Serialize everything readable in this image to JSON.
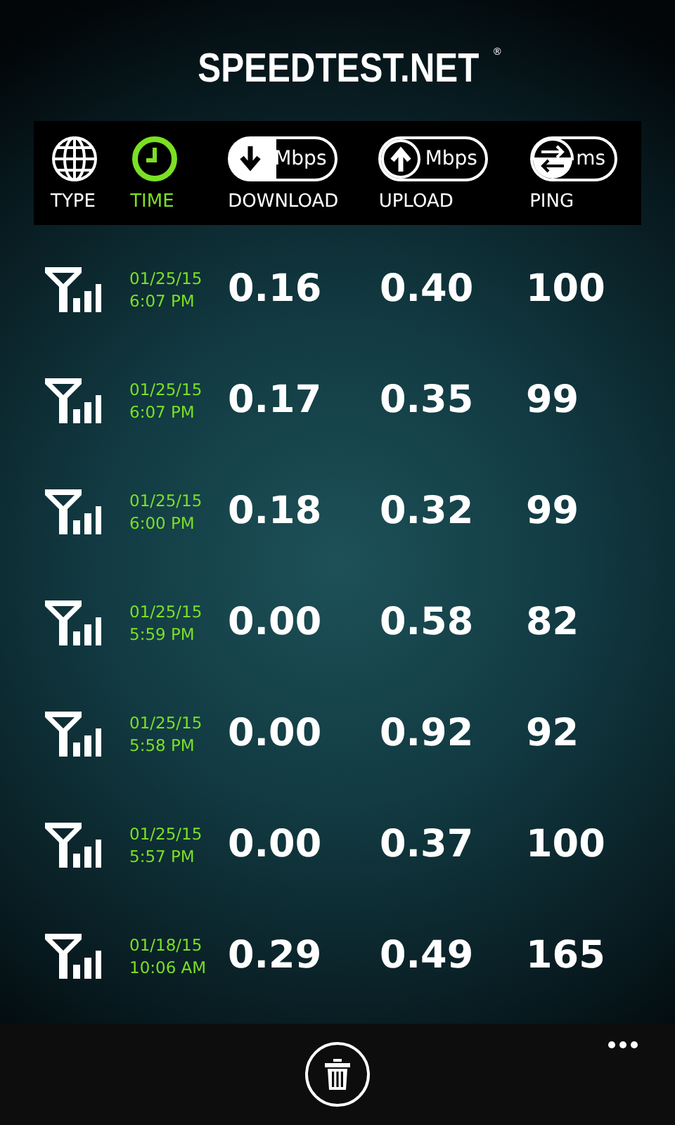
{
  "logo": {
    "text": "SPEEDTEST.NET",
    "mark": "®"
  },
  "columns": [
    {
      "kind": "type",
      "label": "TYPE",
      "selected": false
    },
    {
      "kind": "time",
      "label": "TIME",
      "selected": true
    },
    {
      "kind": "download",
      "label": "DOWNLOAD",
      "unit": "Mbps",
      "selected": false
    },
    {
      "kind": "upload",
      "label": "UPLOAD",
      "unit": "Mbps",
      "selected": false
    },
    {
      "kind": "ping",
      "label": "PING",
      "unit": "ms",
      "selected": false
    }
  ],
  "results": [
    {
      "date": "01/25/15",
      "time": "6:07 PM",
      "download": "0.16",
      "upload": "0.40",
      "ping": "100"
    },
    {
      "date": "01/25/15",
      "time": "6:07 PM",
      "download": "0.17",
      "upload": "0.35",
      "ping": "99"
    },
    {
      "date": "01/25/15",
      "time": "6:00 PM",
      "download": "0.18",
      "upload": "0.32",
      "ping": "99"
    },
    {
      "date": "01/25/15",
      "time": "5:59 PM",
      "download": "0.00",
      "upload": "0.58",
      "ping": "82"
    },
    {
      "date": "01/25/15",
      "time": "5:58 PM",
      "download": "0.00",
      "upload": "0.92",
      "ping": "92"
    },
    {
      "date": "01/25/15",
      "time": "5:57 PM",
      "download": "0.00",
      "upload": "0.37",
      "ping": "100"
    },
    {
      "date": "01/18/15",
      "time": "10:06 AM",
      "download": "0.29",
      "upload": "0.49",
      "ping": "165"
    }
  ]
}
